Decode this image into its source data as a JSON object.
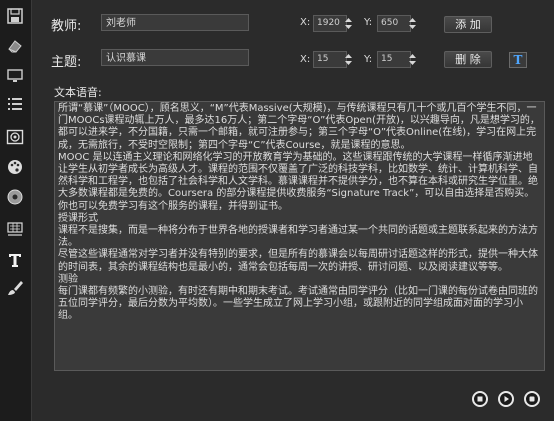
{
  "sidebar": {
    "items": [
      {
        "icon": "save-icon"
      },
      {
        "icon": "eraser-icon"
      },
      {
        "icon": "monitor-icon"
      },
      {
        "icon": "list-icon"
      },
      {
        "icon": "image-icon"
      },
      {
        "icon": "palette-icon"
      },
      {
        "icon": "disc-icon"
      },
      {
        "icon": "keyboard-icon"
      },
      {
        "icon": "text-icon",
        "active": true
      },
      {
        "icon": "brush-icon"
      }
    ]
  },
  "teacher": {
    "label": "教师:",
    "value": "刘老师",
    "x_label": "X:",
    "x_value": "1920",
    "y_label": "Y:",
    "y_value": "650",
    "add_button": "添 加"
  },
  "topic": {
    "label": "主题:",
    "value": "认识慕课",
    "x_label": "X:",
    "x_value": "15",
    "y_label": "Y:",
    "y_value": "15",
    "delete_button": "删 除",
    "text_button": "T"
  },
  "speech": {
    "label": "文本语音:",
    "paragraphs": [
      "所谓“慕课”（MOOC），顾名思义，“M”代表Massive(大规模)，与传统课程只有几十个或几百个学生不同，一门MOOCs课程动辄上万人，最多达16万人；第二个字母“O”代表Open(开放)，以兴趣导向，凡是想学习的，都可以进来学，不分国籍，只需一个邮箱，就可注册参与；第三个字母“O”代表Online(在线)，学习在网上完成，无需旅行，不受时空限制；第四个字母“C”代表Course，就是课程的意思。",
      "MOOC 是以连通主义理论和网络化学习的开放教育学为基础的。这些课程跟传统的大学课程一样循序渐进地让学生从初学者成长为高级人才。课程的范围不仅覆盖了广泛的科技学科，比如数学、统计、计算机科学、自然科学和工程学，也包括了社会科学和人文学科。慕课课程并不提供学分，也不算在本科或研究生学位里。绝大多数课程都是免费的。Coursera 的部分课程提供收费服务“Signature Track”，可以自由选择是否购买。你也可以免费学习有这个服务的课程，并得到证书。",
      "授课形式",
      "课程不是搜集，而是一种将分布于世界各地的授课者和学习者通过某一个共同的话题或主题联系起来的方法方法。",
      "尽管这些课程通常对学习者并没有特别的要求，但是所有的慕课会以每周研讨话题这样的形式，提供一种大体的时间表，其余的课程结构也是最小的，通常会包括每周一次的讲授、研讨问题、以及阅读建议等等。",
      "测验",
      "每门课都有频繁的小测验，有时还有期中和期末考试。考试通常由同学评分（比如一门课的每份试卷由同班的五位同学评分，最后分数为平均数）。一些学生成立了网上学习小组，或跟附近的同学组成面对面的学习小组。"
    ]
  },
  "controls": [
    "stop-icon",
    "play-icon",
    "record-icon"
  ],
  "colors": {
    "background": "#2b2b2b",
    "field": "#3a3a3a",
    "accent": "#4ea6ff"
  }
}
